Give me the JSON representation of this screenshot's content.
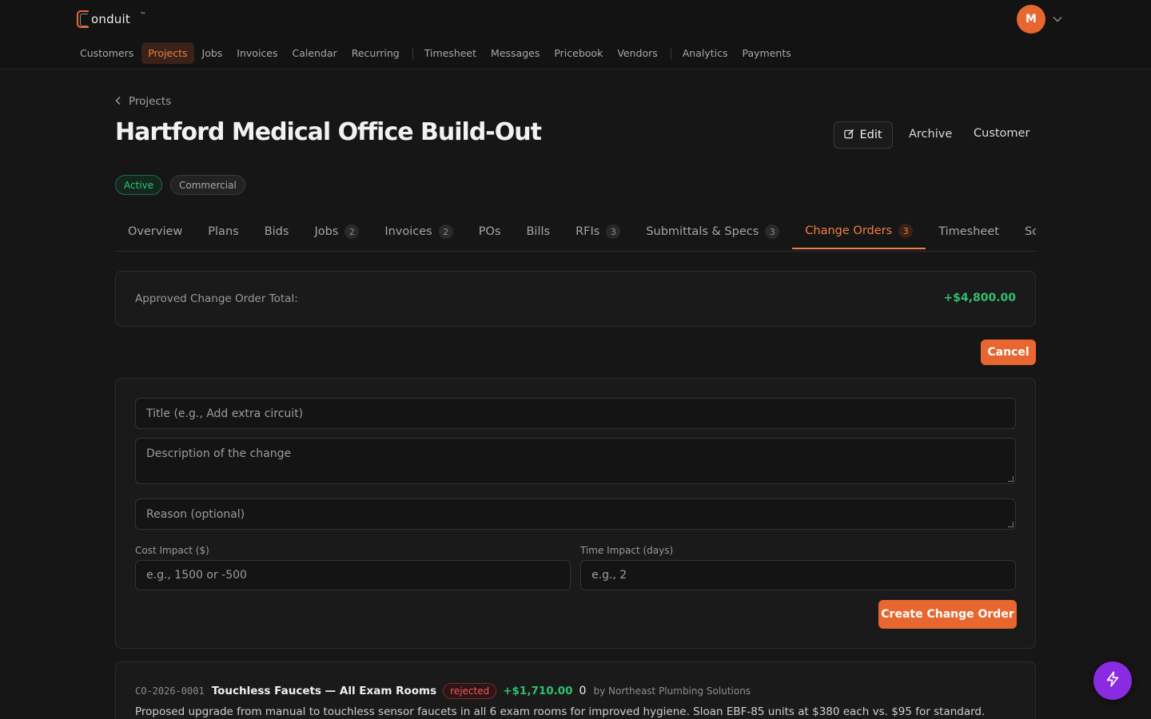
{
  "brand": {
    "name": "onduit",
    "tm": "™",
    "accent": "#e8662f"
  },
  "user": {
    "initial": "M"
  },
  "nav": {
    "items": [
      "Customers",
      "Projects",
      "Jobs",
      "Invoices",
      "Calendar",
      "Recurring",
      "Timesheet",
      "Messages",
      "Pricebook",
      "Vendors",
      "Analytics",
      "Payments"
    ],
    "active": "Projects"
  },
  "breadcrumb": {
    "label": "Projects"
  },
  "project": {
    "title": "Hartford Medical Office Build-Out",
    "status": "Active",
    "type": "Commercial"
  },
  "actions": {
    "edit": "Edit",
    "archive": "Archive",
    "customer": "Customer"
  },
  "tabs": [
    {
      "label": "Overview",
      "count": ""
    },
    {
      "label": "Plans",
      "count": ""
    },
    {
      "label": "Bids",
      "count": ""
    },
    {
      "label": "Jobs",
      "count": "2"
    },
    {
      "label": "Invoices",
      "count": "2"
    },
    {
      "label": "POs",
      "count": ""
    },
    {
      "label": "Bills",
      "count": ""
    },
    {
      "label": "RFIs",
      "count": "3"
    },
    {
      "label": "Submittals & Specs",
      "count": "3"
    },
    {
      "label": "Change Orders",
      "count": "3"
    },
    {
      "label": "Timesheet",
      "count": ""
    },
    {
      "label": "Schedule",
      "count": ""
    }
  ],
  "active_tab": "Change Orders",
  "summary": {
    "label": "Approved Change Order Total:",
    "value": "+$4,800.00"
  },
  "form": {
    "cancel_label": "Cancel",
    "title_placeholder": "Title (e.g., Add extra circuit)",
    "description_placeholder": "Description of the change",
    "reason_placeholder": "Reason (optional)",
    "cost_label": "Cost Impact ($)",
    "cost_placeholder": "e.g., 1500 or -500",
    "time_label": "Time Impact (days)",
    "time_placeholder": "e.g., 2",
    "submit_label": "Create Change Order"
  },
  "change_orders": [
    {
      "number": "CO-2026-0001",
      "title": "Touchless Faucets — All Exam Rooms",
      "status": "rejected",
      "amount": "+$1,710.00",
      "days": "0",
      "by": "by Northeast Plumbing Solutions",
      "description": "Proposed upgrade from manual to touchless sensor faucets in all 6 exam rooms for improved hygiene. Sloan EBF-85 units at $380 each vs. $95 for standard."
    }
  ]
}
